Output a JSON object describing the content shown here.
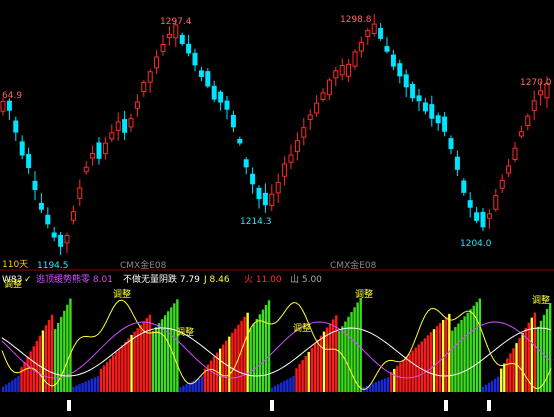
{
  "chart_data": [
    {
      "type": "candlestick",
      "title": "",
      "price_labels": {
        "high_1": "1297.4",
        "high_2": "1298.8",
        "left": "64.9",
        "right": "1270.0",
        "low_1": "1194.5",
        "low_2": "1214.3",
        "low_3": "1204.0"
      },
      "period_label": "110天",
      "watermark_1": "CMX金E08",
      "watermark_2": "CMX金E08",
      "trend": [
        1262,
        1258,
        1248,
        1238,
        1232,
        1222,
        1212,
        1205,
        1198,
        1195,
        1200,
        1210,
        1222,
        1232,
        1238,
        1236,
        1242,
        1248,
        1252,
        1247,
        1255,
        1262,
        1270,
        1276,
        1282,
        1288,
        1294,
        1297,
        1290,
        1284,
        1280,
        1274,
        1270,
        1264,
        1262,
        1258,
        1250,
        1242,
        1232,
        1224,
        1217,
        1214,
        1218,
        1224,
        1232,
        1238,
        1244,
        1250,
        1256,
        1262,
        1266,
        1272,
        1276,
        1278,
        1280,
        1285,
        1290,
        1296,
        1298,
        1292,
        1285,
        1279,
        1274,
        1268,
        1264,
        1262,
        1258,
        1254,
        1252,
        1248,
        1240,
        1230,
        1220,
        1212,
        1206,
        1204,
        1210,
        1218,
        1226,
        1232,
        1240,
        1248,
        1256,
        1262,
        1268,
        1270
      ],
      "colors": {
        "up": "#ff2a2a",
        "down": "#00e5ff"
      }
    },
    {
      "type": "indicator",
      "legend": {
        "name": "W83",
        "chevron": "✓",
        "item_1": "逃顶缓势熊零 8.01",
        "item_2": "不做无量阴跌 7.79",
        "item_3": "J 8.46",
        "item_4": "火 11.00",
        "item_5": "山 5.00"
      },
      "tags": [
        "调整",
        "调整",
        "调整",
        "调整",
        "调整",
        "调整"
      ],
      "colors": {
        "red": "#ff1a1a",
        "green": "#3cdc1e",
        "blue": "#1a2ad8",
        "yellow": "#ffff33",
        "purple": "#d050ff",
        "white": "#ffffff"
      }
    }
  ]
}
